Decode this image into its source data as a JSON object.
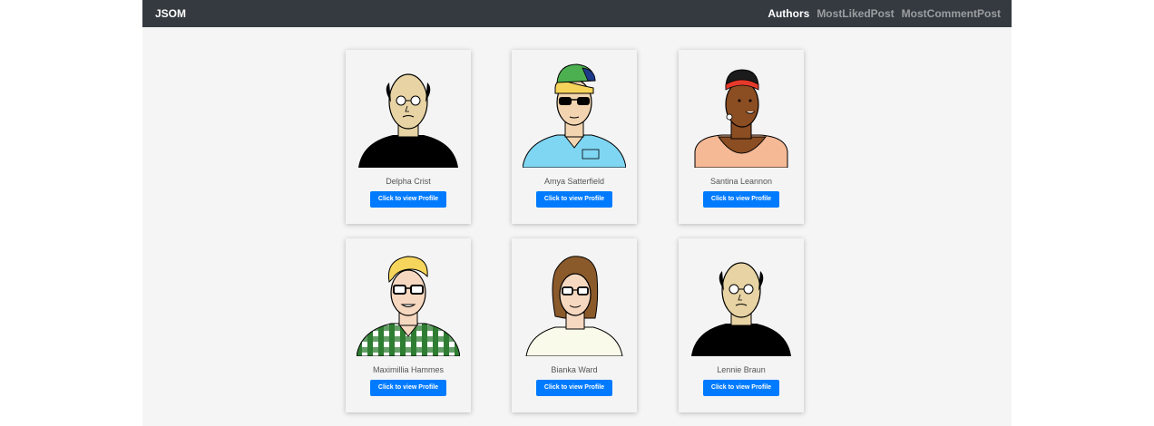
{
  "navbar": {
    "brand": "JSOM",
    "links": [
      {
        "label": "Authors",
        "active": true
      },
      {
        "label": "MostLikedPost",
        "active": false
      },
      {
        "label": "MostCommentPost",
        "active": false
      }
    ]
  },
  "authors": [
    {
      "name": "Delpha Crist",
      "button_label": "Click to view Profile",
      "avatar": "bald-man-glasses-black-turtleneck-icon"
    },
    {
      "name": "Amya Satterfield",
      "button_label": "Click to view Profile",
      "avatar": "man-cap-sunglasses-blue-shirt-icon"
    },
    {
      "name": "Santina Leannon",
      "button_label": "Click to view Profile",
      "avatar": "woman-red-headband-peach-top-icon"
    },
    {
      "name": "Maximillia Hammes",
      "button_label": "Click to view Profile",
      "avatar": "blond-man-glasses-green-plaid-icon"
    },
    {
      "name": "Bianka Ward",
      "button_label": "Click to view Profile",
      "avatar": "brown-hair-woman-glasses-icon"
    },
    {
      "name": "Lennie Braun",
      "button_label": "Click to view Profile",
      "avatar": "bald-man-glasses-black-turtleneck-icon"
    }
  ],
  "colors": {
    "navbar_bg": "#343a40",
    "page_bg": "#f5f5f5",
    "button_bg": "#007bff",
    "link_muted": "rgba(255,255,255,0.5)"
  }
}
